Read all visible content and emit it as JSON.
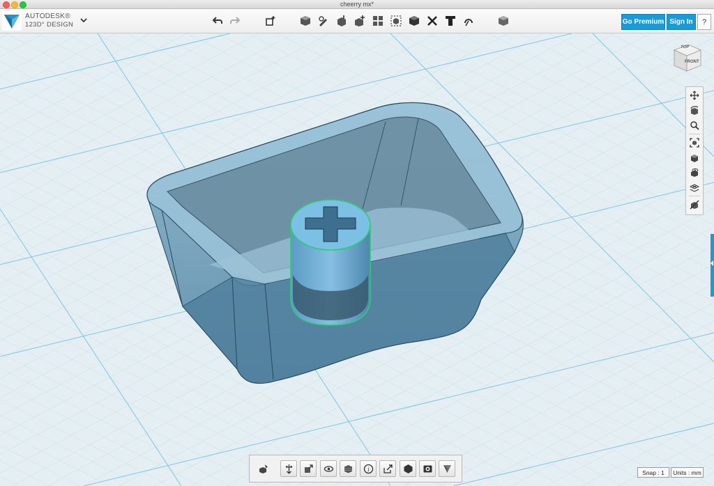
{
  "window": {
    "title": "cheerry mx*"
  },
  "app": {
    "brand_line1": "AUTODESK®",
    "brand_line2": "123D° DESIGN"
  },
  "toolbar": {
    "undo_icon": "undo-icon",
    "redo_icon": "redo-icon",
    "tools": [
      "primitives-icon",
      "sketch-icon",
      "construct-icon",
      "modify-icon",
      "pattern-icon",
      "group-icon",
      "combine-icon",
      "measure-icon",
      "text-icon",
      "snap-icon",
      "material-icon"
    ]
  },
  "account": {
    "premium_label": "Go Premium",
    "signin_label": "Sign In",
    "help_label": "?"
  },
  "viewcube": {
    "top_label": "TOP",
    "front_label": "FRONT"
  },
  "navbar": {
    "items": [
      "pan-icon",
      "orbit-icon",
      "zoom-icon",
      "fit-icon",
      "views-icon",
      "visibility-icon",
      "grid-icon",
      "material-toggle-icon"
    ]
  },
  "bottombar": {
    "items": [
      "selected-object-icon",
      "transform-icon",
      "smart-scale-icon",
      "hide-icon",
      "material-icon",
      "info-icon",
      "export-icon",
      "solid-icon",
      "snapshot-icon",
      "tweak-icon"
    ]
  },
  "status": {
    "snap": "Snap : 1",
    "units": "Units : mm"
  },
  "colors": {
    "accent": "#1a9ad6",
    "grid_bg": "#e4eef3",
    "grid_line": "#8fcde6",
    "model_body": "#5b8fb0",
    "selection": "#2ecc71"
  }
}
